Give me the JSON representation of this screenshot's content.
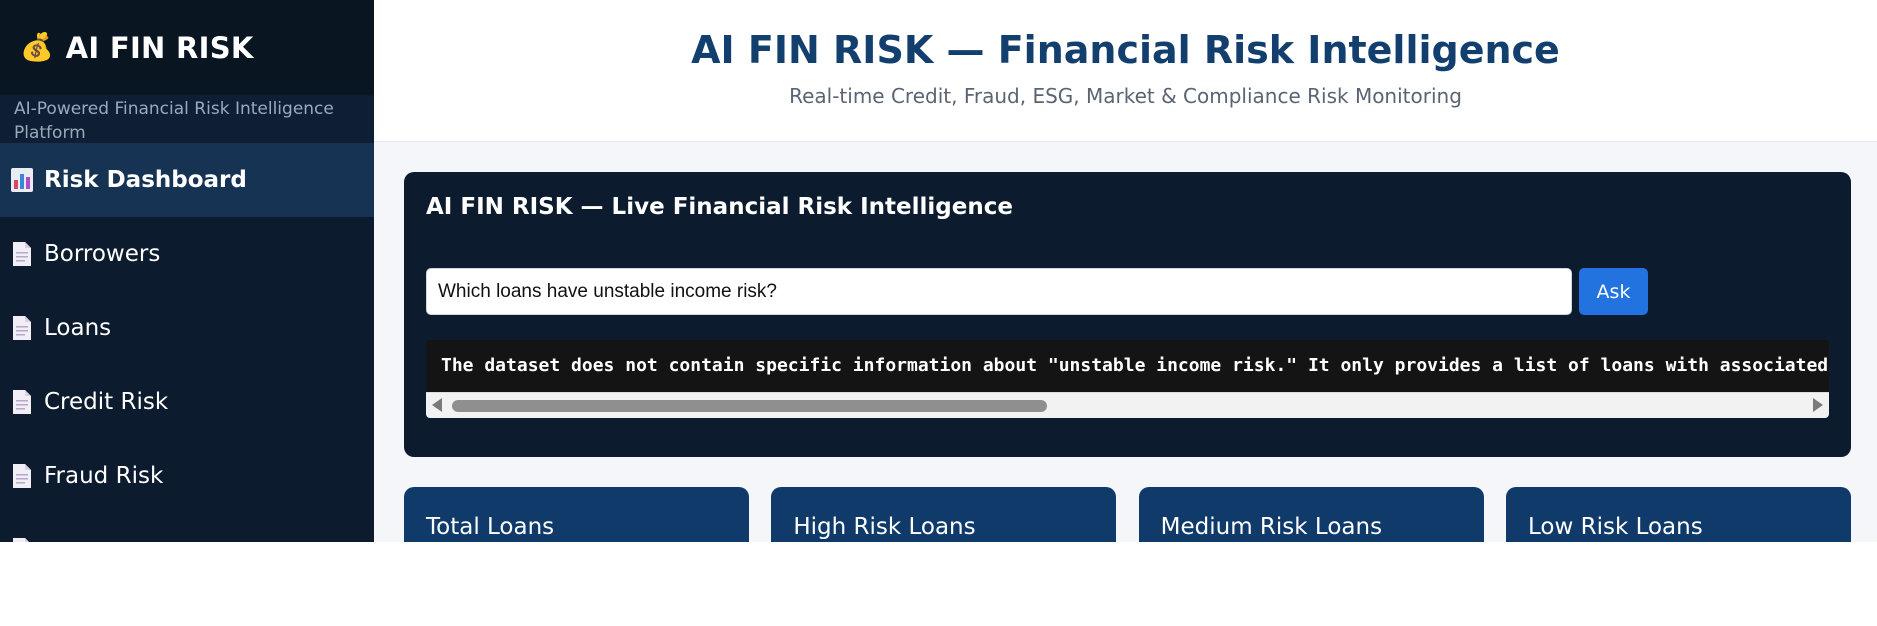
{
  "sidebar": {
    "brand_icon": "💰",
    "brand_title": "AI FIN RISK",
    "tagline": "AI-Powered Financial Risk Intelligence Platform",
    "items": [
      {
        "label": "Risk Dashboard",
        "icon": "bar-chart-icon",
        "active": true
      },
      {
        "label": "Borrowers",
        "icon": "document-icon",
        "active": false
      },
      {
        "label": "Loans",
        "icon": "document-icon",
        "active": false
      },
      {
        "label": "Credit Risk",
        "icon": "document-icon",
        "active": false
      },
      {
        "label": "Fraud Risk",
        "icon": "document-icon",
        "active": false
      }
    ]
  },
  "header": {
    "title": "AI FIN RISK — Financial Risk Intelligence",
    "subtitle": "Real-time Credit, Fraud, ESG, Market & Compliance Risk Monitoring"
  },
  "assistant": {
    "title": "AI FIN RISK — Live Financial Risk Intelligence",
    "query_value": "Which loans have unstable income risk?",
    "ask_label": "Ask",
    "answer": "The dataset does not contain specific information about \"unstable income risk.\" It only provides a list of loans with associated f"
  },
  "stats": [
    {
      "label": "Total Loans"
    },
    {
      "label": "High Risk Loans"
    },
    {
      "label": "Medium Risk Loans"
    },
    {
      "label": "Low Risk Loans"
    }
  ],
  "colors": {
    "sidebar_bg": "#0c1b2d",
    "active_nav": "#173354",
    "title_blue": "#123f6e",
    "ask_button": "#2272e0",
    "stat_card": "#0f3a6a"
  }
}
